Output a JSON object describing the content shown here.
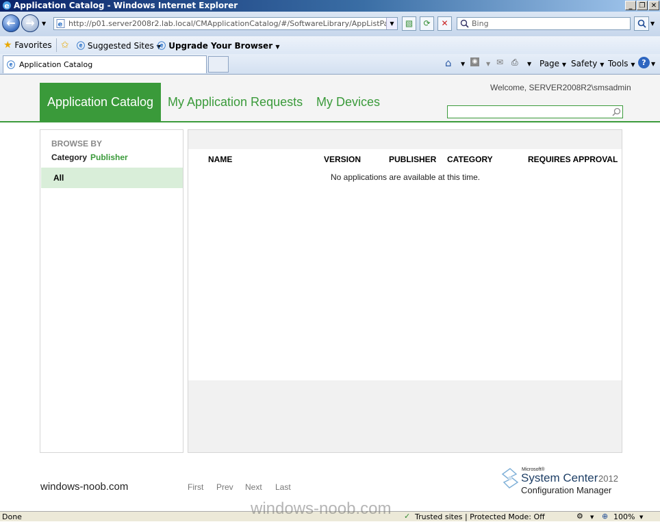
{
  "window": {
    "title": "Application Catalog - Windows Internet Explorer",
    "minimize": "_",
    "restore": "❐",
    "close": "✕"
  },
  "addressbar": {
    "url": "http://p01.server2008r2.lab.local/CMApplicationCatalog/#/SoftwareLibrary/AppListPageView.xa",
    "search_placeholder": "Bing"
  },
  "favorites": {
    "favorites_label": "Favorites",
    "suggested_sites": "Suggested Sites",
    "upgrade_browser": "Upgrade Your Browser"
  },
  "tabs": {
    "active_tab": "Application Catalog"
  },
  "commandbar": {
    "page": "Page",
    "safety": "Safety",
    "tools": "Tools"
  },
  "site": {
    "nav": {
      "catalog": "Application Catalog",
      "requests": "My Application Requests",
      "devices": "My Devices"
    },
    "welcome": "Welcome, SERVER2008R2\\smsadmin",
    "browse_by": "BROWSE BY",
    "category": "Category",
    "publisher": "Publisher",
    "all": "All",
    "columns": [
      "NAME",
      "VERSION",
      "PUBLISHER",
      "CATEGORY",
      "REQUIRES APPROVAL"
    ],
    "empty_message": "No applications are available at this time.",
    "footer_site": "windows-noob.com",
    "pager": [
      "First",
      "Prev",
      "Next",
      "Last"
    ],
    "logo": {
      "microsoft": "Microsoft®",
      "system_center": "System Center",
      "year": "2012",
      "product": "Configuration Manager"
    }
  },
  "watermark": "windows-noob.com",
  "status": {
    "left": "Done",
    "zone": "Trusted sites | Protected Mode: Off",
    "zoom": "100%"
  },
  "colors": {
    "accent_green": "#3a9a3a"
  }
}
